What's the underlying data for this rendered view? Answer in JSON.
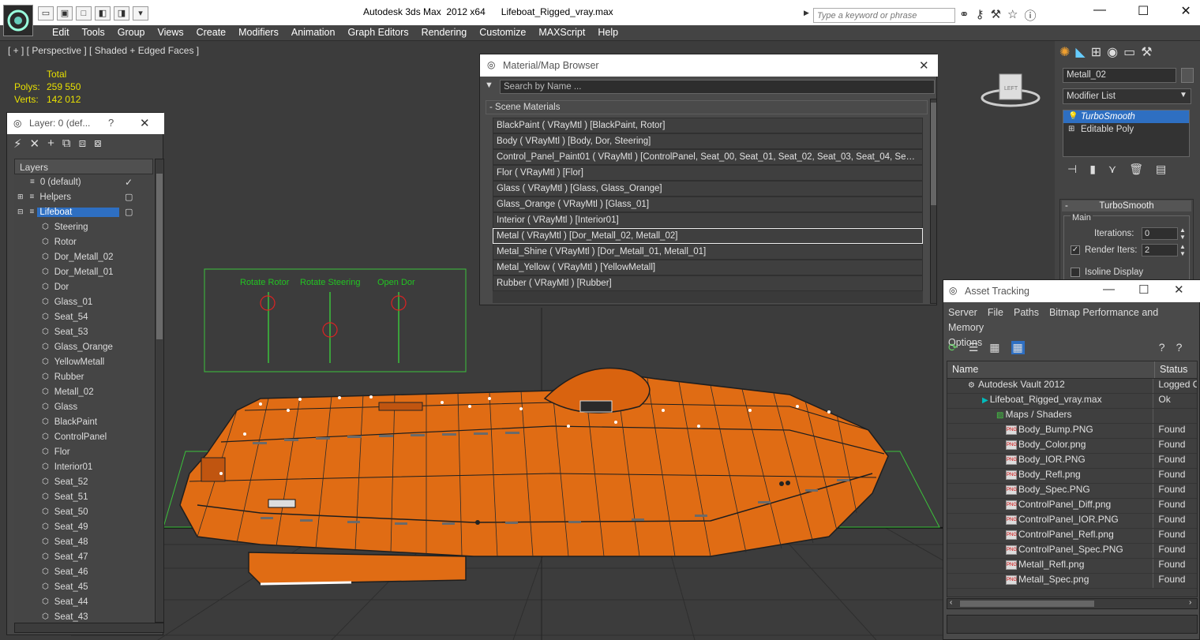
{
  "app": {
    "title": "Autodesk 3ds Max  2012 x64      Lifeboat_Rigged_vray.max",
    "search_placeholder": "Type a keyword or phrase",
    "menus": [
      "Edit",
      "Tools",
      "Group",
      "Views",
      "Create",
      "Modifiers",
      "Animation",
      "Graph Editors",
      "Rendering",
      "Customize",
      "MAXScript",
      "Help"
    ]
  },
  "viewport": {
    "label": "[ + ] [ Perspective ] [ Shaded + Edged Faces ]",
    "stats": {
      "total_label": "Total",
      "polys_label": "Polys:",
      "polys_value": "259 550",
      "verts_label": "Verts:",
      "verts_value": "142 012"
    },
    "rig_labels": [
      "Rotate Rotor",
      "Rotate Steering",
      "Open Dor"
    ],
    "viewcube_label": "LEFT"
  },
  "layer_panel": {
    "title": "Layer: 0 (def...",
    "help": "?",
    "header": "Layers",
    "items": [
      "0 (default)",
      "Helpers",
      "Lifeboat",
      "Steering",
      "Rotor",
      "Dor_Metall_02",
      "Dor_Metall_01",
      "Dor",
      "Glass_01",
      "Seat_54",
      "Seat_53",
      "Glass_Orange",
      "YellowMetall",
      "Rubber",
      "Metall_02",
      "Glass",
      "BlackPaint",
      "ControlPanel",
      "Flor",
      "Interior01",
      "Seat_52",
      "Seat_51",
      "Seat_50",
      "Seat_49",
      "Seat_48",
      "Seat_47",
      "Seat_46",
      "Seat_45",
      "Seat_44",
      "Seat_43"
    ]
  },
  "material_browser": {
    "title": "Material/Map Browser",
    "search_placeholder": "Search by Name ...",
    "group": "- Scene Materials",
    "materials": [
      "BlackPaint  ( VRayMtl )  [BlackPaint, Rotor]",
      "Body  ( VRayMtl )  [Body, Dor, Steering]",
      "Control_Panel_Paint01  ( VRayMtl )  [ControlPanel, Seat_00, Seat_01, Seat_02, Seat_03, Seat_04, Seat_...",
      "Flor  ( VRayMtl )  [Flor]",
      "Glass  ( VRayMtl )  [Glass, Glass_Orange]",
      "Glass_Orange  ( VRayMtl )  [Glass_01]",
      "Interior  ( VRayMtl )  [Interior01]",
      "Metal  ( VRayMtl )  [Dor_Metall_02, Metall_02]",
      "Metal_Shine  ( VRayMtl )  [Dor_Metall_01, Metall_01]",
      "Metal_Yellow  ( VRayMtl )  [YellowMetall]",
      "Rubber  ( VRayMtl )  [Rubber]"
    ]
  },
  "command_panel": {
    "object_name": "Metall_02",
    "modifier_list": "Modifier List",
    "stack": [
      "TurboSmooth",
      "Editable Poly"
    ],
    "rollout_title": "TurboSmooth",
    "main_label": "Main",
    "iterations_label": "Iterations:",
    "iterations_value": "0",
    "render_iters_label": "Render Iters:",
    "render_iters_value": "2",
    "isoline_label": "Isoline Display"
  },
  "asset_tracking": {
    "title": "Asset Tracking",
    "menus": [
      "Server",
      "File",
      "Paths",
      "Bitmap Performance and Memory",
      "Options"
    ],
    "col_name": "Name",
    "col_status": "Status",
    "rows": [
      {
        "name": "Autodesk Vault 2012",
        "status": "Logged O",
        "indent": 1,
        "kind": "vault"
      },
      {
        "name": "Lifeboat_Rigged_vray.max",
        "status": "Ok",
        "indent": 2,
        "kind": "max"
      },
      {
        "name": "Maps / Shaders",
        "status": "",
        "indent": 3,
        "kind": "maps"
      },
      {
        "name": "Body_Bump.PNG",
        "status": "Found",
        "indent": 4,
        "kind": "png"
      },
      {
        "name": "Body_Color.png",
        "status": "Found",
        "indent": 4,
        "kind": "png"
      },
      {
        "name": "Body_IOR.PNG",
        "status": "Found",
        "indent": 4,
        "kind": "png"
      },
      {
        "name": "Body_Refl.png",
        "status": "Found",
        "indent": 4,
        "kind": "png"
      },
      {
        "name": "Body_Spec.PNG",
        "status": "Found",
        "indent": 4,
        "kind": "png"
      },
      {
        "name": "ControlPanel_Diff.png",
        "status": "Found",
        "indent": 4,
        "kind": "png"
      },
      {
        "name": "ControlPanel_IOR.PNG",
        "status": "Found",
        "indent": 4,
        "kind": "png"
      },
      {
        "name": "ControlPanel_Refl.png",
        "status": "Found",
        "indent": 4,
        "kind": "png"
      },
      {
        "name": "ControlPanel_Spec.PNG",
        "status": "Found",
        "indent": 4,
        "kind": "png"
      },
      {
        "name": "Metall_Refl.png",
        "status": "Found",
        "indent": 4,
        "kind": "png"
      },
      {
        "name": "Metall_Spec.png",
        "status": "Found",
        "indent": 4,
        "kind": "png"
      }
    ],
    "png_badge": "PNG"
  },
  "colors": {
    "accent": "#2e6fc2",
    "boat": "#e06c14",
    "stats": "#e8e000",
    "rig": "#22c322"
  }
}
